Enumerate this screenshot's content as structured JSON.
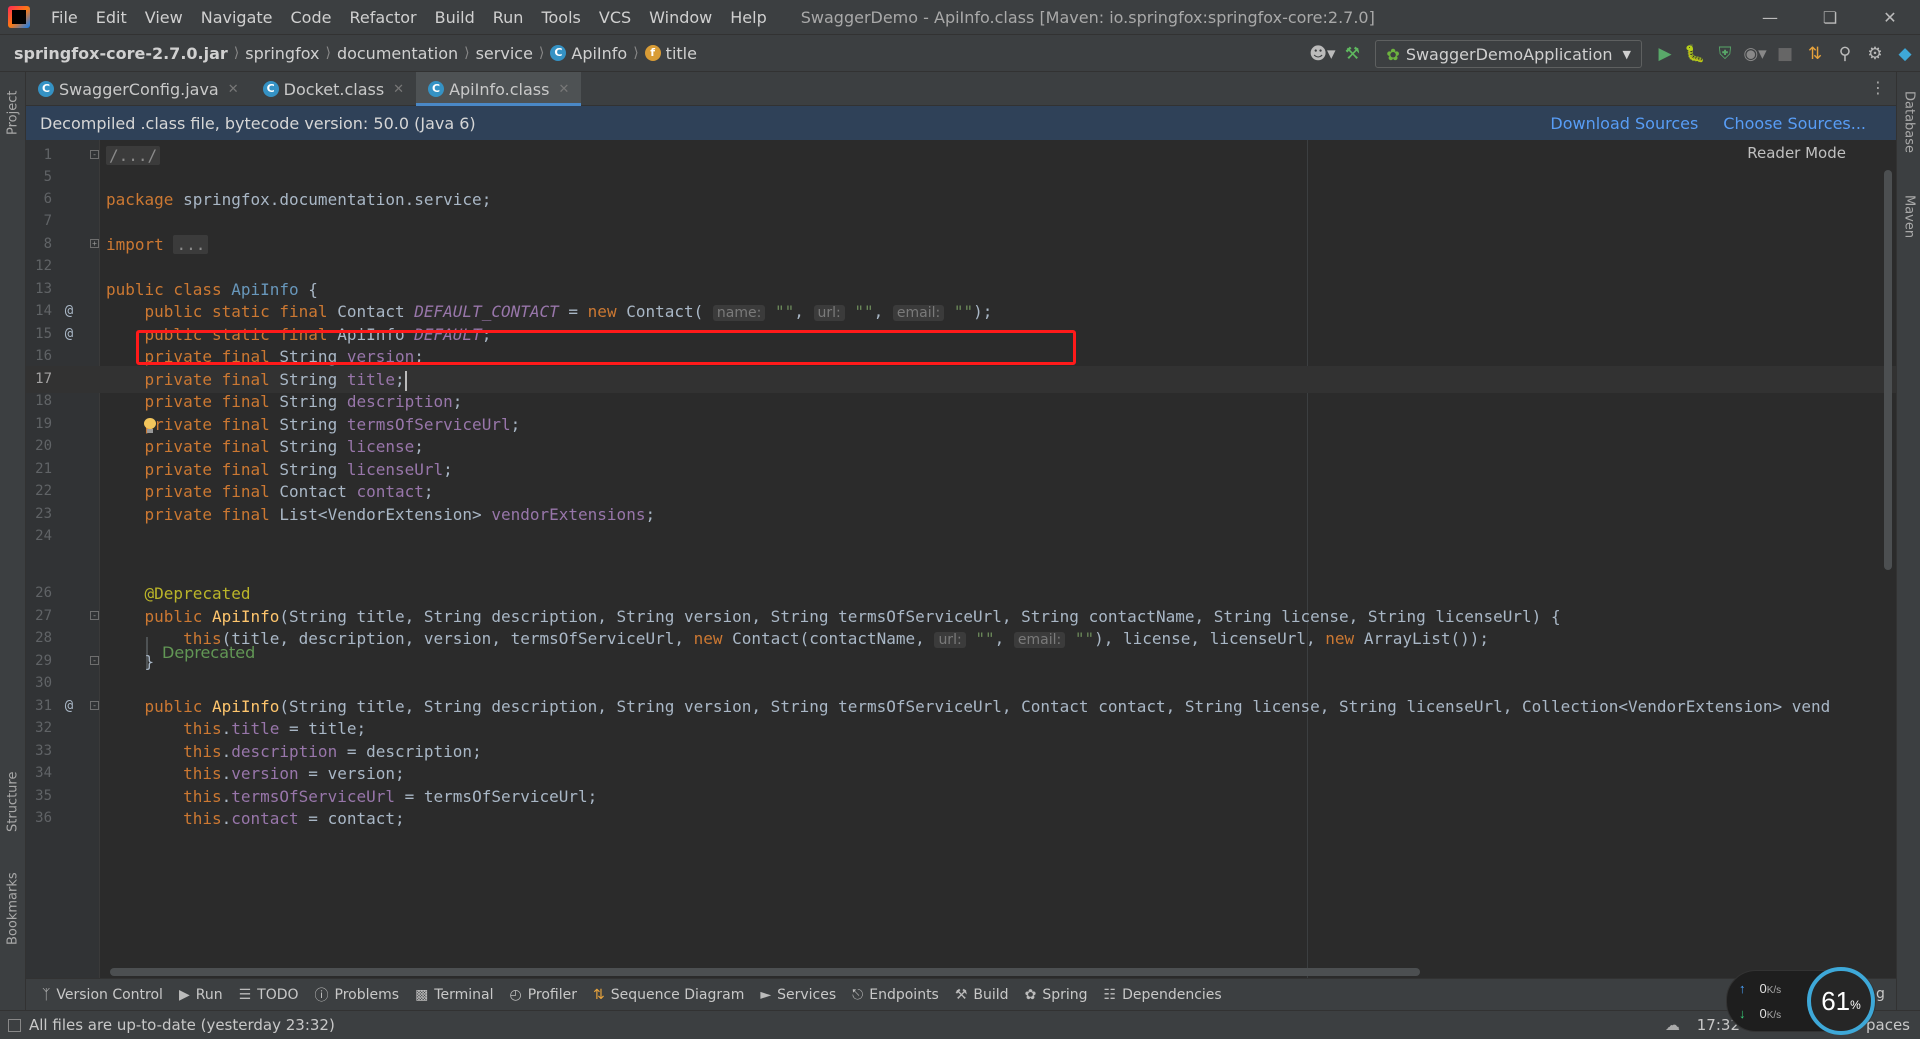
{
  "menubar": {
    "items": [
      "File",
      "Edit",
      "View",
      "Navigate",
      "Code",
      "Refactor",
      "Build",
      "Run",
      "Tools",
      "VCS",
      "Window",
      "Help"
    ],
    "window_title": "SwaggerDemo - ApiInfo.class [Maven: io.springfox:springfox-core:2.7.0]"
  },
  "navbar": {
    "breadcrumb": [
      "springfox-core-2.7.0.jar",
      "springfox",
      "documentation",
      "service",
      "ApiInfo",
      "title"
    ],
    "run_config": "SwaggerDemoApplication"
  },
  "tabs": [
    {
      "label": "SwaggerConfig.java",
      "icon": "class-icon"
    },
    {
      "label": "Docket.class",
      "icon": "class-icon"
    },
    {
      "label": "ApiInfo.class",
      "icon": "class-icon",
      "active": true
    }
  ],
  "banner": {
    "text": "Decompiled .class file, bytecode version: 50.0 (Java 6)",
    "download_sources": "Download Sources",
    "choose_sources": "Choose Sources..."
  },
  "editor": {
    "reader_mode": "Reader Mode",
    "current_line": 17,
    "line_numbers": [
      "1",
      "5",
      "6",
      "7",
      "8",
      "12",
      "13",
      "14",
      "15",
      "16",
      "17",
      "18",
      "19",
      "20",
      "21",
      "22",
      "23",
      "24",
      "",
      "26",
      "27",
      "28",
      "29",
      "30",
      "31",
      "32",
      "33",
      "34",
      "35",
      "36"
    ],
    "deprecated_doc": "Deprecated",
    "hints": {
      "name": "name:",
      "url": "url:",
      "email": "email:"
    }
  },
  "left_stripe": {
    "project": "Project",
    "structure": "Structure",
    "bookmarks": "Bookmarks"
  },
  "right_stripe": {
    "database": "Database",
    "maven": "Maven"
  },
  "bottom_tools": [
    "Version Control",
    "Run",
    "TODO",
    "Problems",
    "Terminal",
    "Profiler",
    "Sequence Diagram",
    "Services",
    "Endpoints",
    "Build",
    "Spring",
    "Dependencies"
  ],
  "statusbar": {
    "text": "All files are up-to-date (yesterday 23:32)",
    "time": "17:32",
    "spaces": "paces"
  },
  "net_widget": {
    "upload": "0",
    "download": "0",
    "unit": "K/s",
    "percent": "61",
    "percent_sign": "%"
  },
  "colors": {
    "keyword": "#cc7832",
    "string": "#6a8759",
    "field": "#9876aa",
    "annotation": "#bbb529",
    "method": "#ffc66d",
    "highlight_box": "#ff1a1a",
    "banner_bg": "#2f4158"
  }
}
